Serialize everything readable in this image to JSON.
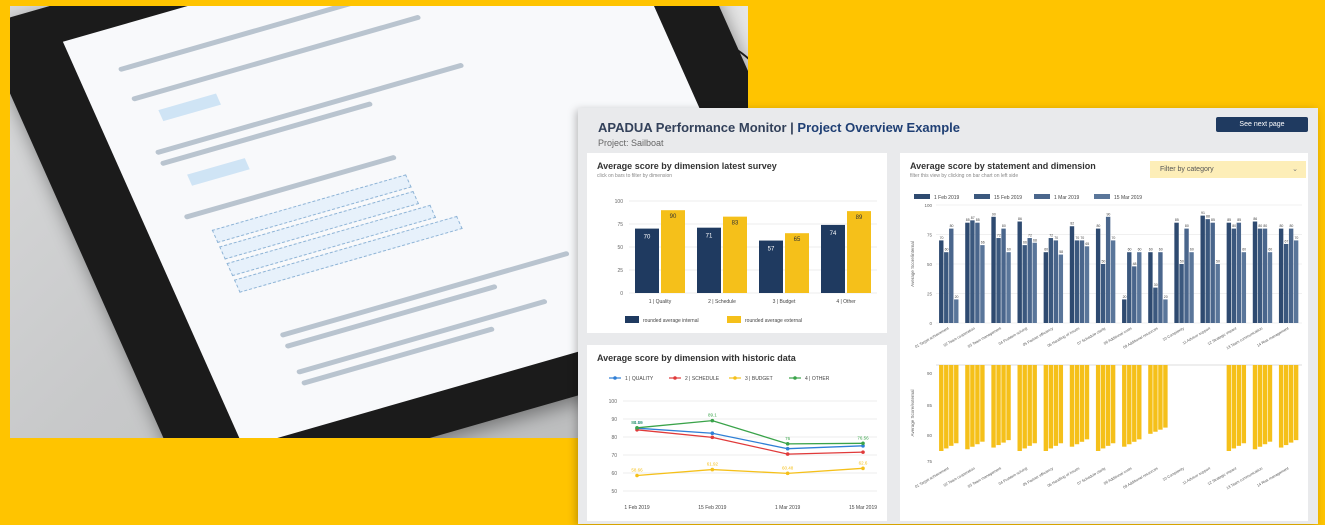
{
  "header": {
    "title_main": "APADUA Performance Monitor",
    "title_sep": "|",
    "title_sub": "Project Overview Example",
    "project": "Project: Sailboat",
    "next_button": "See next page"
  },
  "colors": {
    "navy": "#1f3a60",
    "gold": "#f5c01a",
    "background": "#ffc400"
  },
  "panel1": {
    "title": "Average score by dimension latest survey",
    "subtitle": "click on bars to filter by dimension"
  },
  "panel2": {
    "title": "Average score by dimension with historic data"
  },
  "panel3": {
    "title": "Average score by statement and dimension",
    "subtitle": "filter this view by clicking on bar chart on left side",
    "filter_label": "Filter by category",
    "filter_icon": "chevron-down-icon",
    "y_label_top": "Average Score/internal",
    "y_label_bottom": "Average Score/external"
  },
  "chart_data": [
    {
      "type": "bar",
      "title": "Average score by dimension latest survey",
      "categories": [
        "1 | Quality",
        "2 | Schedule",
        "3 | Budget",
        "4 | Other"
      ],
      "series": [
        {
          "name": "rounded average internal",
          "values": [
            70,
            71,
            57,
            74
          ]
        },
        {
          "name": "rounded average external",
          "values": [
            90,
            83,
            65,
            89
          ]
        }
      ],
      "ylim": [
        0,
        100
      ],
      "yticks": [
        0,
        25,
        50,
        75,
        100
      ],
      "legend": "bottom"
    },
    {
      "type": "line",
      "title": "Average score by dimension with historic data",
      "x": [
        "1 Feb 2019",
        "15 Feb 2019",
        "1 Mar 2019",
        "15 Mar 2019"
      ],
      "series": [
        {
          "name": "1 | QUALITY",
          "color": "#2f7fd6",
          "values": [
            84.89,
            82.1,
            73.5,
            75.1
          ],
          "labels": [
            "84.89",
            "",
            "",
            ""
          ]
        },
        {
          "name": "2 | SCHEDULE",
          "color": "#e03a3a",
          "values": [
            84.0,
            79.8,
            70.5,
            71.6
          ],
          "labels": [
            "",
            "",
            "",
            ""
          ]
        },
        {
          "name": "3 | BUDGET",
          "color": "#f5c01a",
          "values": [
            58.6,
            61.9,
            59.8,
            62.6
          ],
          "labels": [
            "58.66",
            "61.92",
            "60.48",
            "62.6"
          ]
        },
        {
          "name": "4 | OTHER",
          "color": "#3aa34a",
          "values": [
            85.1,
            89.1,
            76.2,
            76.5
          ],
          "labels": [
            "85.16",
            "89.1",
            "76",
            "76.56"
          ]
        }
      ],
      "ylim": [
        50,
        100
      ],
      "yticks": [
        50,
        60,
        70,
        80,
        90,
        100
      ],
      "legend": "top"
    },
    {
      "type": "bar",
      "title": "Average score by statement and dimension",
      "categories": [
        "01 Target achievement",
        "02 Team cooperation",
        "03 Team management",
        "04 Problem solving",
        "05 Partner efficiency",
        "06 Handling of issues",
        "07 Schedule clarity",
        "08 Additional costs",
        "09 Additional resources",
        "10 Complexity",
        "11 Advisor support",
        "12 Strategic impact",
        "13 Team communication",
        "14 Risk management"
      ],
      "series": [
        {
          "name": "1 Feb 2019",
          "values": [
            70,
            85,
            90,
            86,
            60,
            82,
            80,
            20,
            60,
            85,
            91,
            85,
            86,
            80
          ]
        },
        {
          "name": "15 Feb 2019",
          "values": [
            60,
            87,
            72,
            66,
            72,
            70,
            50,
            60,
            30,
            50,
            88,
            80,
            80,
            67
          ]
        },
        {
          "name": "1 Mar 2019",
          "values": [
            80,
            85,
            80,
            72,
            70,
            70,
            90,
            48,
            60,
            80,
            85,
            85,
            80,
            80
          ]
        },
        {
          "name": "15 Mar 2019",
          "values": [
            20,
            66,
            60,
            68,
            58,
            65,
            70,
            60,
            20,
            60,
            50,
            60,
            60,
            70
          ]
        }
      ],
      "ylim": [
        0,
        100
      ],
      "yticks": [
        0,
        25,
        50,
        75,
        100
      ],
      "legend": "top-left"
    },
    {
      "type": "bar",
      "title": "",
      "categories": [
        "01 Target achievement",
        "02 Team cooperation",
        "03 Team management",
        "04 Problem solving",
        "05 Partner efficiency",
        "06 Handling of issues",
        "07 Schedule clarity",
        "08 Additional costs",
        "09 Additional resources",
        "10 Complexity",
        "11 Advisor support",
        "12 Strategic impact",
        "13 Team communication",
        "14 Risk management"
      ],
      "values": [
        100,
        98,
        96,
        100,
        100,
        95,
        100,
        95,
        80,
        0,
        0,
        100,
        98,
        96
      ],
      "ylim": [
        0,
        100
      ],
      "yticks": [
        75,
        80,
        85,
        90
      ],
      "legend": "none"
    }
  ]
}
